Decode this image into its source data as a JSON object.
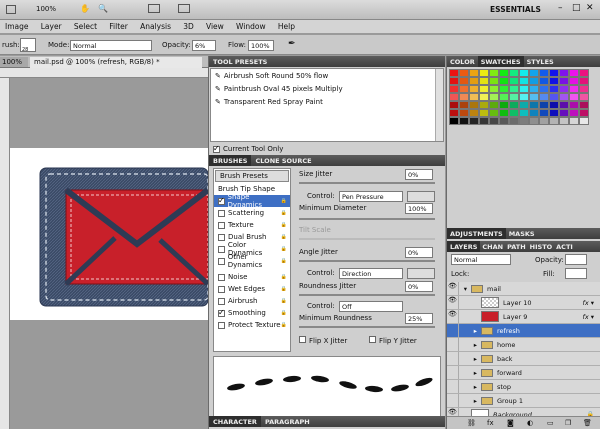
{
  "topbar": {
    "zoom": "100%",
    "workspace": "ESSENTIALS"
  },
  "menu": [
    "Image",
    "Layer",
    "Select",
    "Filter",
    "Analysis",
    "3D",
    "View",
    "Window",
    "Help"
  ],
  "options": {
    "brush_label": "rush:",
    "brush_size": "28",
    "mode_label": "Mode:",
    "mode_value": "Normal",
    "opacity_label": "Opacity:",
    "opacity_value": "6%",
    "flow_label": "Flow:",
    "flow_value": "100%"
  },
  "document": {
    "zoom_tab": "100%",
    "tab_title": "mail.psd @ 100% (refresh, RGB/8) *"
  },
  "tool_presets": {
    "tabs": [
      "TOOL PRESETS"
    ],
    "items": [
      "Airbrush Soft Round 50% flow",
      "Paintbrush Oval 45 pixels Multiply",
      "Transparent Red Spray Paint"
    ],
    "current_only": "Current Tool Only"
  },
  "brushes": {
    "tabs": [
      "BRUSHES",
      "CLONE SOURCE"
    ],
    "presets_button": "Brush Presets",
    "tip_shape": "Brush Tip Shape",
    "options": [
      {
        "label": "Shape Dynamics",
        "checked": true,
        "selected": true
      },
      {
        "label": "Scattering",
        "checked": false
      },
      {
        "label": "Texture",
        "checked": false
      },
      {
        "label": "Dual Brush",
        "checked": false
      },
      {
        "label": "Color Dynamics",
        "checked": false
      },
      {
        "label": "Other Dynamics",
        "checked": false
      },
      {
        "label": "Noise",
        "checked": false
      },
      {
        "label": "Wet Edges",
        "checked": false
      },
      {
        "label": "Airbrush",
        "checked": false
      },
      {
        "label": "Smoothing",
        "checked": true
      },
      {
        "label": "Protect Texture",
        "checked": false
      }
    ],
    "size_jitter_label": "Size Jitter",
    "size_jitter": "0%",
    "control_label": "Control:",
    "control1": "Pen Pressure",
    "min_diameter_label": "Minimum Diameter",
    "min_diameter": "100%",
    "tilt_scale_label": "Tilt Scale",
    "angle_jitter_label": "Angle Jitter",
    "angle_jitter": "0%",
    "control2": "Direction",
    "roundness_jitter_label": "Roundness Jitter",
    "roundness_jitter": "0%",
    "control3": "Off",
    "min_roundness_label": "Minimum Roundness",
    "min_roundness": "25%",
    "flip_x": "Flip X Jitter",
    "flip_y": "Flip Y Jitter"
  },
  "bottom_tabs": [
    "CHARACTER",
    "PARAGRAPH"
  ],
  "color_panel": {
    "tabs": [
      "COLOR",
      "SWATCHES",
      "STYLES"
    ]
  },
  "adjustments": {
    "tabs": [
      "ADJUSTMENTS",
      "MASKS"
    ]
  },
  "layers": {
    "tabs": [
      "LAYERS",
      "CHAN",
      "PATH",
      "HISTO",
      "ACTI"
    ],
    "blend": "Normal",
    "opacity_label": "Opacity:",
    "fill_label": "Fill:",
    "lock_label": "Lock:",
    "items": [
      {
        "name": "mail",
        "type": "group",
        "indent": 0,
        "eye": true
      },
      {
        "name": "Layer 10",
        "type": "layer",
        "indent": 1,
        "eye": true,
        "fx": true
      },
      {
        "name": "Layer 9",
        "type": "layer",
        "indent": 1,
        "eye": true,
        "fx": true
      },
      {
        "name": "refresh",
        "type": "group",
        "indent": 1,
        "eye": false,
        "selected": true
      },
      {
        "name": "home",
        "type": "group",
        "indent": 1,
        "eye": false
      },
      {
        "name": "back",
        "type": "group",
        "indent": 1,
        "eye": false
      },
      {
        "name": "forward",
        "type": "group",
        "indent": 1,
        "eye": false
      },
      {
        "name": "stop",
        "type": "group",
        "indent": 1,
        "eye": false
      },
      {
        "name": "Group 1",
        "type": "group",
        "indent": 1,
        "eye": false
      },
      {
        "name": "Background",
        "type": "bg",
        "indent": 0,
        "eye": true
      }
    ]
  },
  "colors": {
    "panel_head": "#4a4a4a",
    "selection": "#3e6fc4",
    "envelope_red": "#c8202a",
    "denim": "#3a4a66"
  }
}
